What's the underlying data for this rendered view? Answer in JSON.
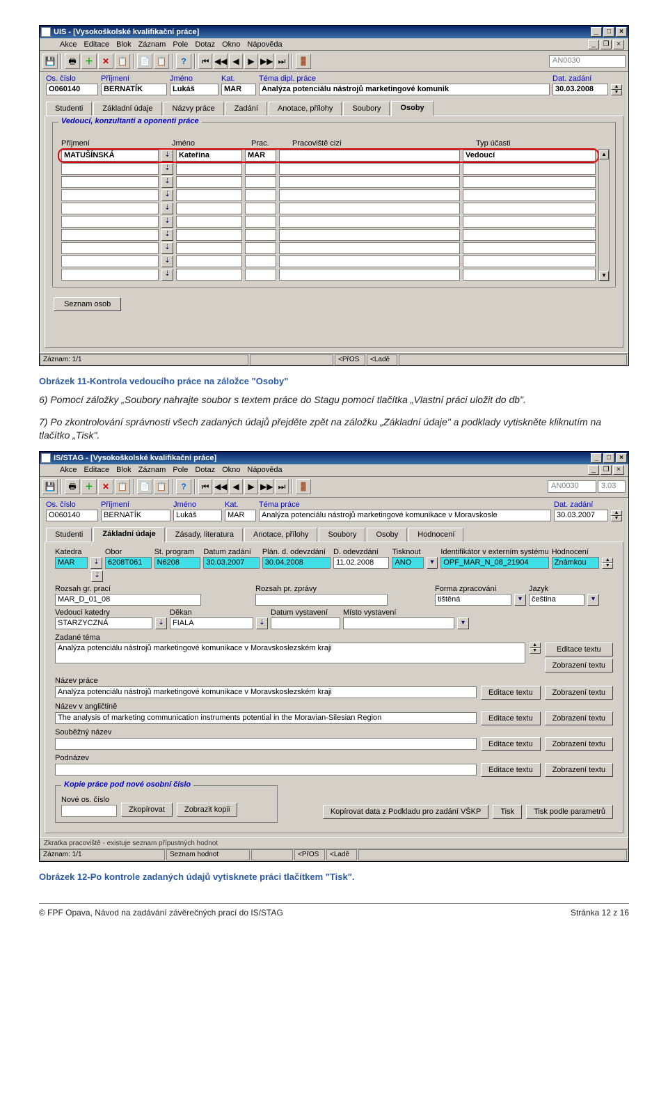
{
  "fig1": {
    "title": "UIS - [Vysokoškolské kvalifikační práce]",
    "menus": [
      "Akce",
      "Editace",
      "Blok",
      "Záznam",
      "Pole",
      "Dotaz",
      "Okno",
      "Nápověda"
    ],
    "code": "AN0030",
    "header": {
      "labels": {
        "os": "Os. číslo",
        "prijmeni": "Příjmení",
        "jmeno": "Jméno",
        "kat": "Kat.",
        "tema": "Téma dipl. práce",
        "dat": "Dat. zadání"
      },
      "os": "O060140",
      "prijmeni": "BERNATÍK",
      "jmeno": "Lukáš",
      "kat": "MAR",
      "tema": "Analýza potenciálu nástrojů marketingové komunik",
      "dat": "30.03.2008"
    },
    "tabs": [
      "Studenti",
      "Základní údaje",
      "Názvy práce",
      "Zadání",
      "Anotace, přílohy",
      "Soubory",
      "Osoby"
    ],
    "active_tab": 6,
    "group_label": "Vedoucí, konzultanti a oponenti práce",
    "grid_headers": {
      "prijmeni": "Příjmení",
      "jmeno": "Jméno",
      "prac": "Prac.",
      "prac_cizi": "Pracoviště cizí",
      "typ": "Typ účasti"
    },
    "grid_row": {
      "prijmeni": "MATUŠÍNSKÁ",
      "jmeno": "Kateřina",
      "prac": "MAR",
      "prac_cizi": "",
      "typ": "Vedoucí"
    },
    "seznam_btn": "Seznam osob",
    "status": {
      "rec": "Záznam: 1/1",
      "scroll": "<PřOS",
      "scroll2": "<Ladě"
    }
  },
  "caption1": "Obrázek 11-Kontrola vedoucího práce na záložce \"Osoby\"",
  "para1": "6) Pomocí záložky „Soubory nahrajte soubor s textem práce do Stagu pomocí tlačítka „Vlastní práci uložit do db\".",
  "para2": "7) Po zkontrolování správnosti všech zadaných údajů přejděte zpět na záložku „Základní údaje\" a podklady vytiskněte kliknutím na tlačítko „Tisk\".",
  "fig2": {
    "title": "IS/STAG - [Vysokoškolské kvalifikační práce]",
    "menus": [
      "Akce",
      "Editace",
      "Blok",
      "Záznam",
      "Pole",
      "Dotaz",
      "Okno",
      "Nápověda"
    ],
    "code": "AN0030",
    "code2": "3.03",
    "header": {
      "labels": {
        "os": "Os. číslo",
        "prijmeni": "Příjmení",
        "jmeno": "Jméno",
        "kat": "Kat.",
        "tema": "Téma práce",
        "dat": "Dat. zadání"
      },
      "os": "O060140",
      "prijmeni": "BERNATÍK",
      "jmeno": "Lukáš",
      "kat": "MAR",
      "tema": "Analýza potenciálu nástrojů marketingové komunikace v Moravskosle",
      "dat": "30.03.2007"
    },
    "tabs": [
      "Studenti",
      "Základní údaje",
      "Zásady, literatura",
      "Anotace, přílohy",
      "Soubory",
      "Osoby",
      "Hodnocení"
    ],
    "active_tab": 1,
    "row1_labels": {
      "kat": "Katedra",
      "obor": "Obor",
      "prog": "St. program",
      "dz": "Datum zadání",
      "pdo": "Plán. d. odevzdání",
      "do": "D. odevzdání",
      "tisk": "Tisknout",
      "ident": "Identifikátor v externím systému",
      "hod": "Hodnocení"
    },
    "row1": {
      "kat": "MAR",
      "obor": "6208T061",
      "prog": "N6208",
      "dz": "30.03.2007",
      "pdo": "30.04.2008",
      "do": "11.02.2008",
      "tisk": "ANO",
      "ident": "OPF_MAR_N_08_21904",
      "hod": "Známkou"
    },
    "row2_labels": {
      "rozsah": "Rozsah gr. prací",
      "rozsah2": "Rozsah pr. zprávy",
      "forma": "Forma zpracování",
      "jazyk": "Jazyk"
    },
    "row2": {
      "rozsah": "MAR_D_01_08",
      "rozsah2": "",
      "forma": "tištěná",
      "jazyk": "čeština"
    },
    "row3_labels": {
      "vk": "Vedoucí katedry",
      "dekan": "Děkan",
      "dv": "Datum vystavení",
      "mv": "Místo vystavení"
    },
    "row3": {
      "vk": "STARZYCZNÁ",
      "dekan": "FIALA",
      "dv": "",
      "mv": ""
    },
    "zadane_label": "Zadané téma",
    "zadane": "Analýza potenciálu nástrojů marketingové komunikace v Moravskoslezském kraji",
    "nazev_label": "Název práce",
    "nazev": "Analýza potenciálu nástrojů marketingové komunikace v Moravskoslezském kraji",
    "nazevE_label": "Název v angličtině",
    "nazevE": "The analysis of marketing communication instruments potential in the Moravian-Silesian Region",
    "soub_label": "Souběžný název",
    "soub": "",
    "pod_label": "Podnázev",
    "pod": "",
    "edit_btn": "Editace textu",
    "view_btn": "Zobrazení textu",
    "kopie_label": "Kopie práce pod nové osobní číslo",
    "nove_label": "Nové os. číslo",
    "zkop": "Zkopírovat",
    "zkopii": "Zobrazit kopii",
    "kop_data": "Kopírovat data z Podkladu pro zadání VŠKP",
    "tisk": "Tisk",
    "tiskp": "Tisk podle parametrů",
    "status": {
      "hint": "Zkratka pracoviště - existuje seznam přípustných hodnot",
      "rec": "Záznam: 1/1",
      "sh": "Seznam hodnot",
      "scroll": "<PřOS",
      "scroll2": "<Ladě"
    }
  },
  "caption2": "Obrázek 12-Po kontrole zadaných údajů vytisknete práci tlačítkem \"Tisk\".",
  "footer": {
    "left": "© FPF Opava, Návod na zadávání závěrečných prací do IS/STAG",
    "right": "Stránka 12 z 16"
  }
}
